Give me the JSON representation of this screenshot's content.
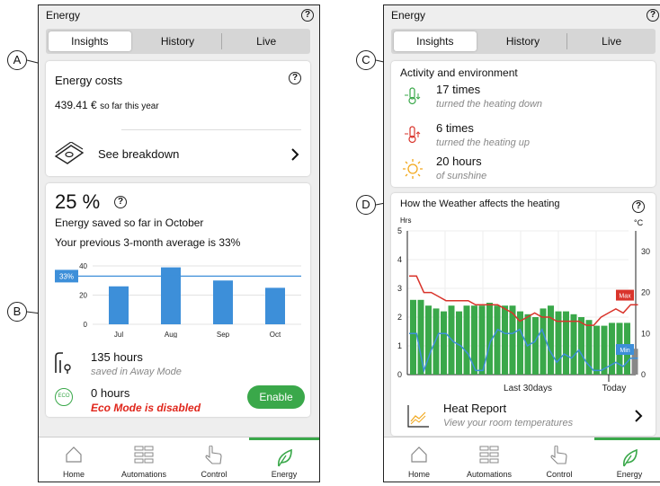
{
  "callouts": {
    "a": "A",
    "b": "B",
    "c": "C",
    "d": "D"
  },
  "left": {
    "title": "Energy",
    "tabs": [
      "Insights",
      "History",
      "Live"
    ],
    "costs": {
      "title": "Energy costs",
      "amount": "439.41 €",
      "amount_note": "so far this year",
      "breakdown": "See breakdown"
    },
    "savings": {
      "percent": "25 %",
      "line1": "Energy saved so far in October",
      "line2": "Your previous 3-month average is 33%",
      "avg_marker": "33%",
      "away_hours": "135 hours",
      "away_note": "saved in Away Mode",
      "eco_hours": "0 hours",
      "eco_note": "Eco Mode is disabled",
      "eco_badge": "ECO",
      "enable": "Enable"
    },
    "chart_data": {
      "type": "bar",
      "categories": [
        "Jul",
        "Aug",
        "Sep",
        "Oct"
      ],
      "values": [
        26,
        39,
        30,
        25
      ],
      "ylim": [
        0,
        40
      ],
      "yticks": [
        "0",
        "20",
        "40"
      ],
      "average_line": 33,
      "color": "#3d8fd9"
    }
  },
  "right": {
    "title": "Energy",
    "tabs": [
      "Insights",
      "History",
      "Live"
    ],
    "activity": {
      "title": "Activity and environment",
      "items": [
        {
          "value": "17 times",
          "note": "turned the heating down",
          "icon": "thermometer-down-icon",
          "color": "#3aa84a"
        },
        {
          "value": "6 times",
          "note": "turned the heating up",
          "icon": "thermometer-up-icon",
          "color": "#d9342b"
        },
        {
          "value": "20 hours",
          "note": "of sunshine",
          "icon": "sun-icon",
          "color": "#f2a81d"
        }
      ]
    },
    "weather": {
      "title": "How the Weather affects the heating",
      "y_left_unit": "Hrs",
      "y_right_unit": "°C",
      "y_left_ticks": [
        "0",
        "1",
        "2",
        "3",
        "4",
        "5"
      ],
      "y_right_ticks": [
        "0",
        "10",
        "20",
        "30"
      ],
      "x_label": "Last 30days",
      "x_today": "Today",
      "max_label": "Max",
      "min_label": "Min",
      "report_title": "Heat Report",
      "report_note": "View your room temperatures"
    },
    "chart_data": {
      "type": "bar",
      "series": [
        {
          "name": "",
          "kind": "bar",
          "unit": "Hrs",
          "values": [
            2.6,
            2.6,
            2.4,
            2.3,
            2.2,
            2.4,
            2.2,
            2.4,
            2.4,
            2.4,
            2.5,
            2.4,
            2.4,
            2.4,
            2.2,
            2.1,
            2.0,
            2.3,
            2.4,
            2.2,
            2.2,
            2.1,
            2.0,
            1.9,
            1.7,
            1.7,
            1.8,
            1.8,
            1.8,
            0.9
          ]
        },
        {
          "name": "Max",
          "kind": "line",
          "unit": "°C",
          "color": "#d9342b",
          "values": [
            24,
            24,
            20,
            20,
            19,
            18,
            18,
            18,
            18,
            17,
            17,
            17,
            17,
            16,
            15,
            13,
            14,
            15,
            14,
            14,
            13,
            13,
            13,
            13,
            12,
            12,
            14,
            15,
            16,
            15,
            17,
            17
          ]
        },
        {
          "name": "Min",
          "kind": "line",
          "unit": "°C",
          "color": "#3d8fd9",
          "values": [
            10,
            10,
            1,
            6,
            10,
            10,
            8,
            7,
            5,
            1,
            1,
            8,
            11,
            10,
            10,
            11,
            7,
            8,
            11,
            6,
            3,
            5,
            4,
            6,
            3,
            1,
            1,
            2,
            3,
            2,
            4,
            4
          ]
        }
      ],
      "ylim_left": [
        0,
        5
      ],
      "ylim_right": [
        0,
        35
      ],
      "bar_color": "#3aa84a",
      "today_color": "#888888"
    }
  },
  "nav": [
    "Home",
    "Automations",
    "Control",
    "Energy"
  ]
}
